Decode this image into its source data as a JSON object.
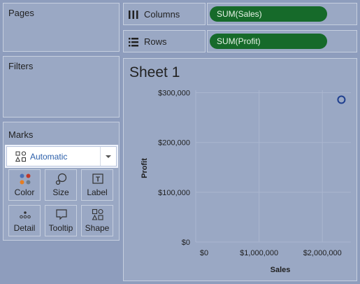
{
  "panels": {
    "pages": "Pages",
    "filters": "Filters",
    "marks": "Marks"
  },
  "marks": {
    "type": "Automatic",
    "buttons": [
      {
        "key": "color",
        "label": "Color"
      },
      {
        "key": "size",
        "label": "Size"
      },
      {
        "key": "label",
        "label": "Label"
      },
      {
        "key": "detail",
        "label": "Detail"
      },
      {
        "key": "tooltip",
        "label": "Tooltip"
      },
      {
        "key": "shape",
        "label": "Shape"
      }
    ]
  },
  "shelves": {
    "columns": {
      "label": "Columns",
      "pill": "SUM(Sales)"
    },
    "rows": {
      "label": "Rows",
      "pill": "SUM(Profit)"
    }
  },
  "sheet": {
    "title": "Sheet 1"
  },
  "colors": {
    "pill": "#166a2a",
    "mark": "#1f3f8f",
    "background": "#8e9dbd"
  },
  "chart_data": {
    "type": "scatter",
    "xlabel": "Sales",
    "ylabel": "Profit",
    "x_ticks": [
      "$0",
      "$1,000,000",
      "$2,000,000"
    ],
    "y_ticks": [
      "$0",
      "$100,000",
      "$200,000",
      "$300,000"
    ],
    "xlim": [
      0,
      2450000
    ],
    "ylim": [
      0,
      305000
    ],
    "points": [
      {
        "x": 2300000,
        "y": 286000
      }
    ],
    "grid": true
  }
}
